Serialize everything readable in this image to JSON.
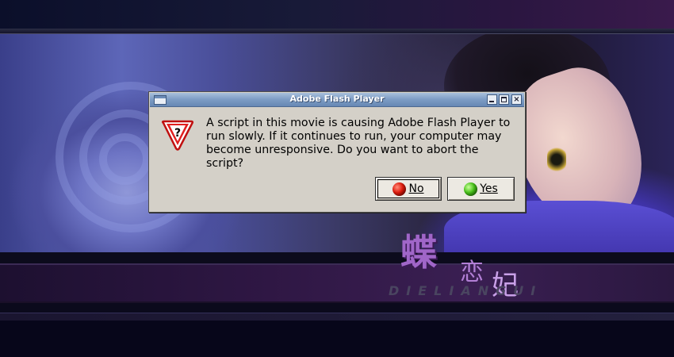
{
  "background": {
    "logo_text_1": "蝶",
    "logo_text_2": "恋",
    "logo_text_3": "妃",
    "logo_latin": "DIELIANGUI"
  },
  "dialog": {
    "title": "Adobe Flash Player",
    "icon": "question-warning-icon",
    "message": "A script in this movie is causing Adobe Flash Player to run slowly. If it continues to run, your computer may become unresponsive. Do you want to abort the script?",
    "buttons": {
      "no_label": "No",
      "no_icon": "red-circle-icon",
      "yes_label": "Yes",
      "yes_icon": "green-circle-icon"
    },
    "window_controls": [
      "minimize-icon",
      "maximize-icon",
      "close-icon"
    ]
  },
  "colors": {
    "titlebar": "#7c9cc4",
    "dialog_bg": "#d4d0c8",
    "no_dot": "#e01b0c",
    "yes_dot": "#49c21a"
  }
}
